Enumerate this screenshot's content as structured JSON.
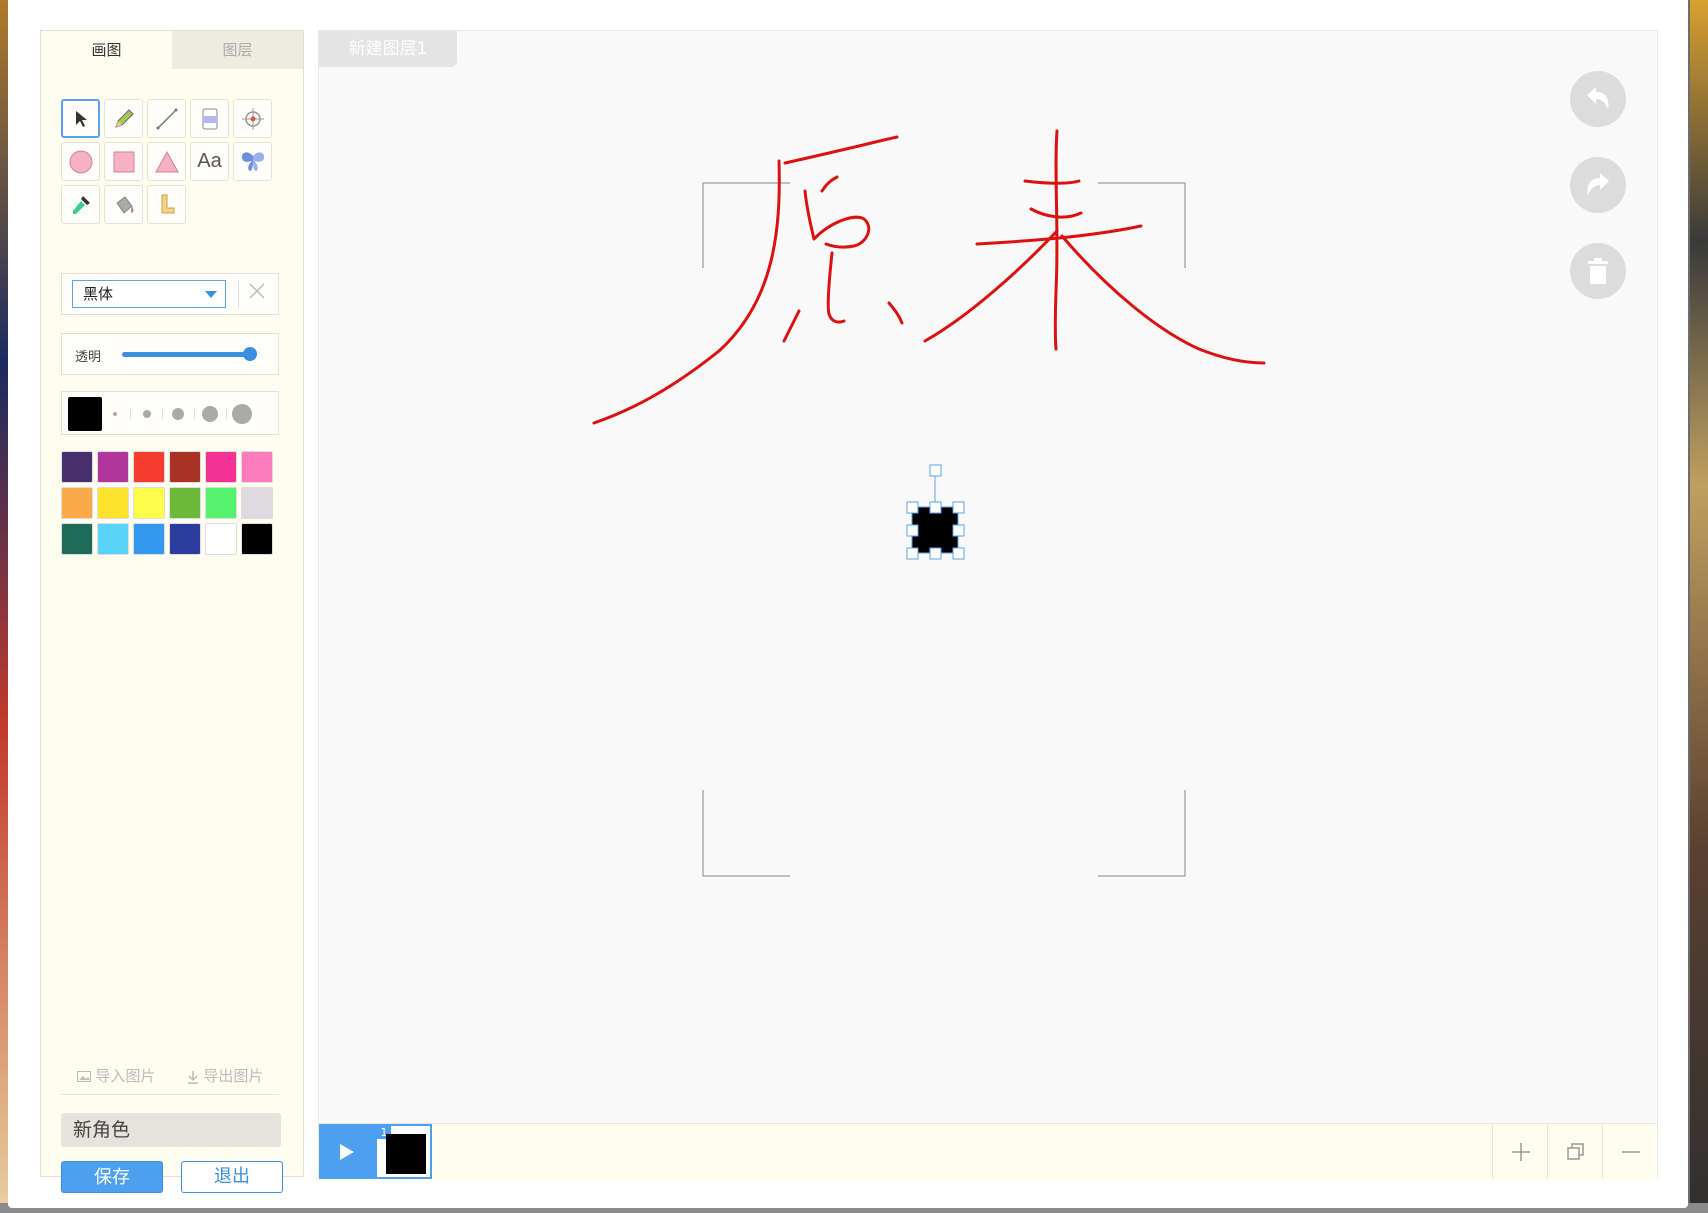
{
  "tabs": {
    "draw": "画图",
    "layers": "图层"
  },
  "tools": [
    {
      "name": "select-tool",
      "icon": "arrow-cursor-icon"
    },
    {
      "name": "pencil-tool",
      "icon": "pencil-icon"
    },
    {
      "name": "line-tool",
      "icon": "line-icon"
    },
    {
      "name": "eraser-tool",
      "icon": "eraser-icon"
    },
    {
      "name": "target-tool",
      "icon": "crosshair-icon"
    },
    {
      "name": "circle-tool",
      "icon": "circle-icon"
    },
    {
      "name": "rectangle-tool",
      "icon": "square-icon"
    },
    {
      "name": "triangle-tool",
      "icon": "triangle-icon"
    },
    {
      "name": "text-tool",
      "icon": "text-icon",
      "label": "Aa"
    },
    {
      "name": "butterfly-tool",
      "icon": "butterfly-icon"
    },
    {
      "name": "eyedropper-tool",
      "icon": "eyedropper-icon"
    },
    {
      "name": "fill-bucket-tool",
      "icon": "paint-bucket-icon"
    },
    {
      "name": "ruler-tool",
      "icon": "ruler-icon"
    }
  ],
  "font": {
    "selected": "黑体"
  },
  "opacity": {
    "label": "透明",
    "value": 1.0
  },
  "brush": {
    "current_color": "#000000",
    "sizes": [
      1,
      2,
      3,
      4,
      5
    ]
  },
  "palette": [
    "#4a2f6e",
    "#b0369c",
    "#f43d2f",
    "#a93426",
    "#f33294",
    "#fc7cbd",
    "#fbaa4b",
    "#fde22e",
    "#fefc4b",
    "#6cb839",
    "#55f36d",
    "#dedae0",
    "#1e6b5a",
    "#5ad3f8",
    "#3399ee",
    "#2c3c9c",
    "#ffffff",
    "#000000"
  ],
  "actions": {
    "import_image": "导入图片",
    "export_image": "导出图片"
  },
  "character_name": "新角色",
  "buttons": {
    "save": "保存",
    "exit": "退出"
  },
  "layer_tab": "新建图层1",
  "controls": [
    {
      "name": "undo-button",
      "icon": "undo-icon"
    },
    {
      "name": "redo-button",
      "icon": "redo-icon"
    },
    {
      "name": "delete-button",
      "icon": "trash-icon"
    }
  ],
  "timeline": {
    "frame_number": "1"
  },
  "colors": {
    "accent": "#4d9ff0",
    "stroke": "#dd1111"
  }
}
